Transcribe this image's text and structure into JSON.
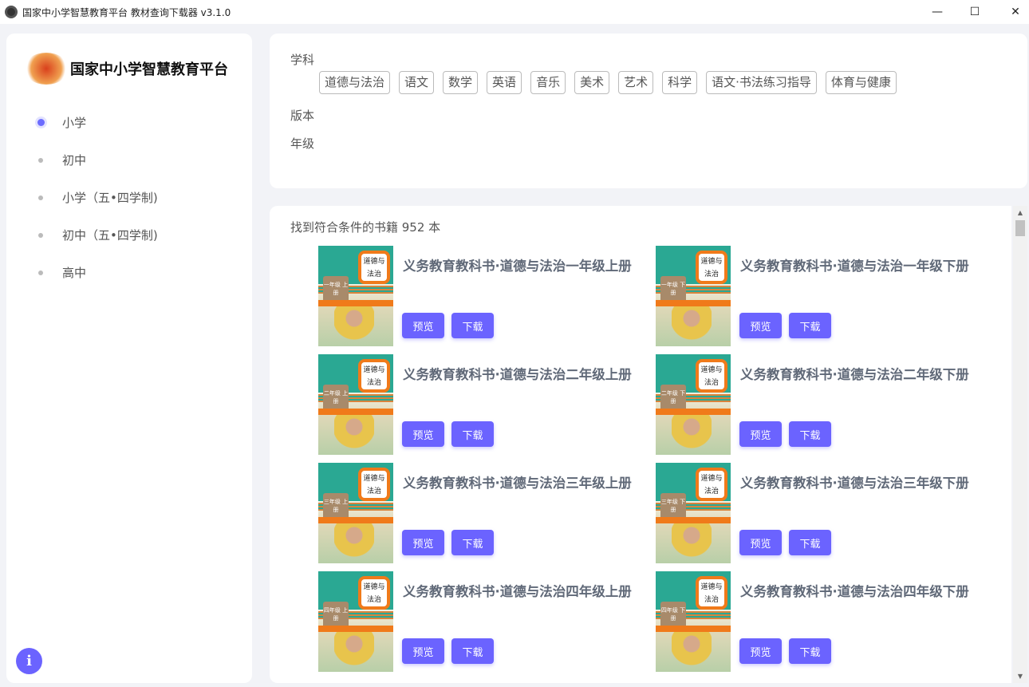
{
  "window": {
    "title": "国家中小学智慧教育平台 教材查询下载器 v3.1.0",
    "minimize": "—",
    "maximize": "☐",
    "close": "✕"
  },
  "sidebar": {
    "logo_text": "国家中小学智慧教育平台",
    "items": [
      {
        "label": "小学",
        "active": true
      },
      {
        "label": "初中"
      },
      {
        "label": "小学（五•四学制)"
      },
      {
        "label": "初中（五•四学制)"
      },
      {
        "label": "高中"
      }
    ],
    "info": "i"
  },
  "filter": {
    "subject_label": "学科",
    "edition_label": "版本",
    "grade_label": "年级",
    "subjects": [
      "道德与法治",
      "语文",
      "数学",
      "英语",
      "音乐",
      "美术",
      "艺术",
      "科学",
      "语文·书法练习指导",
      "体育与健康"
    ]
  },
  "results": {
    "count_text": "找到符合条件的书籍 952 本",
    "preview_label": "预览",
    "download_label": "下载",
    "books": [
      {
        "title": "义务教育教科书·道德与法治一年级上册",
        "cover_grade": "一年级 上册"
      },
      {
        "title": "义务教育教科书·道德与法治一年级下册",
        "cover_grade": "一年级 下册"
      },
      {
        "title": "义务教育教科书·道德与法治二年级上册",
        "cover_grade": "二年级 上册"
      },
      {
        "title": "义务教育教科书·道德与法治二年级下册",
        "cover_grade": "二年级 下册"
      },
      {
        "title": "义务教育教科书·道德与法治三年级上册",
        "cover_grade": "三年级 上册"
      },
      {
        "title": "义务教育教科书·道德与法治三年级下册",
        "cover_grade": "三年级 下册"
      },
      {
        "title": "义务教育教科书·道德与法治四年级上册",
        "cover_grade": "四年级 上册"
      },
      {
        "title": "义务教育教科书·道德与法治四年级下册",
        "cover_grade": "四年级 下册"
      }
    ],
    "cover_title": "道德与法治"
  }
}
